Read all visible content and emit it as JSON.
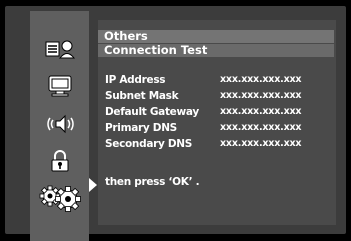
{
  "sidebar": {
    "items": [
      {
        "icon": "picture-speaker-icon"
      },
      {
        "icon": "display-icon"
      },
      {
        "icon": "audio-icon"
      },
      {
        "icon": "lock-icon"
      },
      {
        "icon": "gears-icon",
        "selected": true
      }
    ]
  },
  "panel": {
    "title": "Others",
    "subtitle": "Connection Test",
    "rows": [
      {
        "label": "IP Address",
        "value": "xxx.xxx.xxx.xxx"
      },
      {
        "label": "Subnet Mask",
        "value": "xxx.xxx.xxx.xxx"
      },
      {
        "label": "Default Gateway",
        "value": "xxx.xxx.xxx.xxx"
      },
      {
        "label": "Primary DNS",
        "value": "xxx.xxx.xxx.xxx"
      },
      {
        "label": "Secondary DNS",
        "value": "xxx.xxx.xxx.xxx"
      }
    ],
    "instruction": "then press ‘OK’ ."
  }
}
